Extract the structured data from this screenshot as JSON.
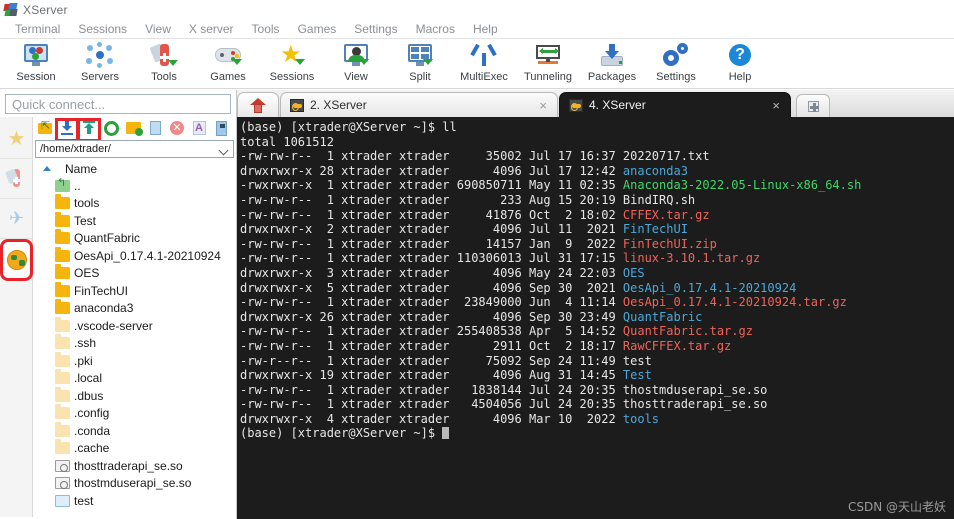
{
  "window": {
    "title": "XServer",
    "logo_icon": "mobaxterm-logo-icon"
  },
  "menubar": {
    "items": [
      {
        "label": "Terminal"
      },
      {
        "label": "Sessions"
      },
      {
        "label": "View"
      },
      {
        "label": "X server"
      },
      {
        "label": "Tools"
      },
      {
        "label": "Games"
      },
      {
        "label": "Settings"
      },
      {
        "label": "Macros"
      },
      {
        "label": "Help"
      }
    ]
  },
  "ribbon": {
    "buttons": [
      {
        "label": "Session",
        "icon": "session-monitor-icon"
      },
      {
        "label": "Servers",
        "icon": "servers-nodes-icon"
      },
      {
        "label": "Tools",
        "icon": "swiss-knife-icon"
      },
      {
        "label": "Games",
        "icon": "gamepad-icon"
      },
      {
        "label": "Sessions",
        "icon": "star-icon"
      },
      {
        "label": "View",
        "icon": "view-monitor-icon"
      },
      {
        "label": "Split",
        "icon": "split-layout-icon"
      },
      {
        "label": "MultiExec",
        "icon": "multiexec-fork-icon"
      },
      {
        "label": "Tunneling",
        "icon": "tunneling-icon"
      },
      {
        "label": "Packages",
        "icon": "packages-download-icon"
      },
      {
        "label": "Settings",
        "icon": "gear-icon"
      },
      {
        "label": "Help",
        "icon": "help-question-icon"
      }
    ]
  },
  "quick_connect": {
    "placeholder": "Quick connect..."
  },
  "vertical_sidebar": {
    "items": [
      {
        "icon": "star-sessions-icon",
        "highlighted": false
      },
      {
        "icon": "tools-knife-icon",
        "highlighted": false
      },
      {
        "icon": "paper-plane-icon",
        "highlighted": false
      },
      {
        "icon": "globe-sftp-icon",
        "highlighted": true
      }
    ]
  },
  "file_browser": {
    "toolbar": [
      {
        "icon": "go-up-folder-icon",
        "highlighted": false
      },
      {
        "icon": "download-icon",
        "highlighted": true
      },
      {
        "icon": "upload-icon",
        "highlighted": true
      },
      {
        "icon": "refresh-icon",
        "highlighted": false
      },
      {
        "icon": "new-folder-icon",
        "highlighted": false
      },
      {
        "icon": "new-file-icon",
        "highlighted": false
      },
      {
        "icon": "delete-icon",
        "highlighted": false
      },
      {
        "icon": "text-mode-icon",
        "highlighted": false
      },
      {
        "icon": "binary-mode-icon",
        "highlighted": false
      }
    ],
    "path": "/home/xtrader/",
    "column_header": "Name",
    "rows": [
      {
        "name": "..",
        "type": "up"
      },
      {
        "name": "tools",
        "type": "folder"
      },
      {
        "name": "Test",
        "type": "folder"
      },
      {
        "name": "QuantFabric",
        "type": "folder"
      },
      {
        "name": "OesApi_0.17.4.1-20210924",
        "type": "folder"
      },
      {
        "name": "OES",
        "type": "folder"
      },
      {
        "name": "FinTechUI",
        "type": "folder"
      },
      {
        "name": "anaconda3",
        "type": "folder"
      },
      {
        "name": ".vscode-server",
        "type": "folder-hidden"
      },
      {
        "name": ".ssh",
        "type": "folder-hidden"
      },
      {
        "name": ".pki",
        "type": "folder-hidden"
      },
      {
        "name": ".local",
        "type": "folder-hidden"
      },
      {
        "name": ".dbus",
        "type": "folder-hidden"
      },
      {
        "name": ".config",
        "type": "folder-hidden"
      },
      {
        "name": ".conda",
        "type": "folder-hidden"
      },
      {
        "name": ".cache",
        "type": "folder-hidden"
      },
      {
        "name": "thosttraderapi_se.so",
        "type": "so"
      },
      {
        "name": "thostmduserapi_se.so",
        "type": "so"
      },
      {
        "name": "test",
        "type": "file"
      }
    ]
  },
  "tabs": {
    "home_icon": "home-icon",
    "items": [
      {
        "label": "2. XServer",
        "active": false,
        "icon": "key-icon",
        "close": "×"
      },
      {
        "label": "4. XServer",
        "active": true,
        "icon": "key-icon",
        "close": "×"
      }
    ],
    "new_tab_icon": "plus-icon"
  },
  "terminal": {
    "colors": {
      "background": "#1c1c1c",
      "default_text": "#e6e6e6",
      "directory": "#4ba8d8",
      "executable": "#3fd66a",
      "archive": "#f0635b"
    },
    "lines": [
      {
        "segments": [
          {
            "t": "(base) [xtrader@XServer ~]$ ll",
            "c": "white"
          }
        ]
      },
      {
        "segments": [
          {
            "t": "total 1061512",
            "c": "white"
          }
        ]
      },
      {
        "segments": [
          {
            "t": "-rw-rw-r--  1 xtrader xtrader     35002 Jul 17 16:37 ",
            "c": "white"
          },
          {
            "t": "20220717.txt",
            "c": "white"
          }
        ]
      },
      {
        "segments": [
          {
            "t": "drwxrwxr-x 28 xtrader xtrader      4096 Jul 17 12:42 ",
            "c": "white"
          },
          {
            "t": "anaconda3",
            "c": "blue"
          }
        ]
      },
      {
        "segments": [
          {
            "t": "-rwxrwxr-x  1 xtrader xtrader 690850711 May 11 02:35 ",
            "c": "white"
          },
          {
            "t": "Anaconda3-2022.05-Linux-x86_64.sh",
            "c": "green"
          }
        ]
      },
      {
        "segments": [
          {
            "t": "-rw-rw-r--  1 xtrader xtrader       233 Aug 15 20:19 ",
            "c": "white"
          },
          {
            "t": "BindIRQ.sh",
            "c": "white"
          }
        ]
      },
      {
        "segments": [
          {
            "t": "-rw-rw-r--  1 xtrader xtrader     41876 Oct  2 18:02 ",
            "c": "white"
          },
          {
            "t": "CFFEX.tar.gz",
            "c": "red"
          }
        ]
      },
      {
        "segments": [
          {
            "t": "drwxrwxr-x  2 xtrader xtrader      4096 Jul 11  2021 ",
            "c": "white"
          },
          {
            "t": "FinTechUI",
            "c": "blue"
          }
        ]
      },
      {
        "segments": [
          {
            "t": "-rw-rw-r--  1 xtrader xtrader     14157 Jan  9  2022 ",
            "c": "white"
          },
          {
            "t": "FinTechUI.zip",
            "c": "red"
          }
        ]
      },
      {
        "segments": [
          {
            "t": "-rw-rw-r--  1 xtrader xtrader 110306013 Jul 31 17:15 ",
            "c": "white"
          },
          {
            "t": "linux-3.10.1.tar.gz",
            "c": "red"
          }
        ]
      },
      {
        "segments": [
          {
            "t": "drwxrwxr-x  3 xtrader xtrader      4096 May 24 22:03 ",
            "c": "white"
          },
          {
            "t": "OES",
            "c": "blue"
          }
        ]
      },
      {
        "segments": [
          {
            "t": "drwxrwxr-x  5 xtrader xtrader      4096 Sep 30  2021 ",
            "c": "white"
          },
          {
            "t": "OesApi_0.17.4.1-20210924",
            "c": "blue"
          }
        ]
      },
      {
        "segments": [
          {
            "t": "-rw-rw-r--  1 xtrader xtrader  23849000 Jun  4 11:14 ",
            "c": "white"
          },
          {
            "t": "OesApi_0.17.4.1-20210924.tar.gz",
            "c": "red"
          }
        ]
      },
      {
        "segments": [
          {
            "t": "drwxrwxr-x 26 xtrader xtrader      4096 Sep 30 23:49 ",
            "c": "white"
          },
          {
            "t": "QuantFabric",
            "c": "blue"
          }
        ]
      },
      {
        "segments": [
          {
            "t": "-rw-rw-r--  1 xtrader xtrader 255408538 Apr  5 14:52 ",
            "c": "white"
          },
          {
            "t": "QuantFabric.tar.gz",
            "c": "red"
          }
        ]
      },
      {
        "segments": [
          {
            "t": "-rw-rw-r--  1 xtrader xtrader      2911 Oct  2 18:17 ",
            "c": "white"
          },
          {
            "t": "RawCFFEX.tar.gz",
            "c": "red"
          }
        ]
      },
      {
        "segments": [
          {
            "t": "-rw-r--r--  1 xtrader xtrader     75092 Sep 24 11:49 ",
            "c": "white"
          },
          {
            "t": "test",
            "c": "white"
          }
        ]
      },
      {
        "segments": [
          {
            "t": "drwxrwxr-x 19 xtrader xtrader      4096 Aug 31 14:45 ",
            "c": "white"
          },
          {
            "t": "Test",
            "c": "blue"
          }
        ]
      },
      {
        "segments": [
          {
            "t": "-rw-rw-r--  1 xtrader xtrader   1838144 Jul 24 20:35 ",
            "c": "white"
          },
          {
            "t": "thostmduserapi_se.so",
            "c": "white"
          }
        ]
      },
      {
        "segments": [
          {
            "t": "-rw-rw-r--  1 xtrader xtrader   4504056 Jul 24 20:35 ",
            "c": "white"
          },
          {
            "t": "thosttraderapi_se.so",
            "c": "white"
          }
        ]
      },
      {
        "segments": [
          {
            "t": "drwxrwxr-x  4 xtrader xtrader      4096 Mar 10  2022 ",
            "c": "white"
          },
          {
            "t": "tools",
            "c": "blue"
          }
        ]
      }
    ],
    "prompt": "(base) [xtrader@XServer ~]$ "
  },
  "watermark": "CSDN @天山老妖"
}
